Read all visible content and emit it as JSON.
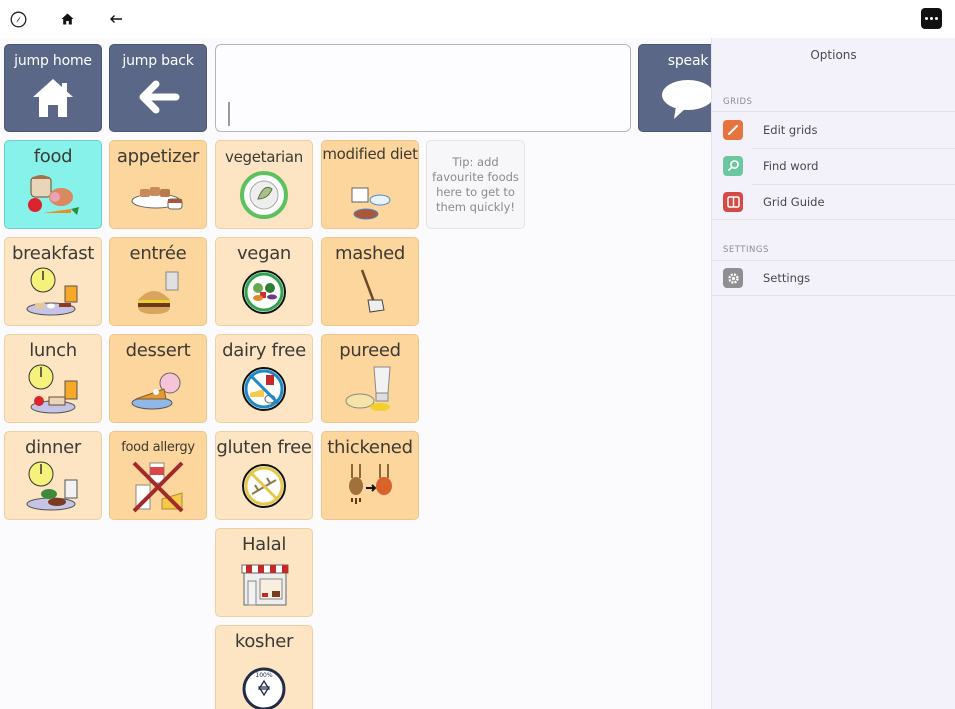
{
  "topbar": {
    "icons": [
      "compass-icon",
      "home-icon",
      "back-arrow-icon",
      "more-icon"
    ]
  },
  "nav": {
    "jump_home": "jump home",
    "jump_back": "jump back",
    "speak": "speak"
  },
  "message_bar": {
    "value": ""
  },
  "grid": {
    "tiles": {
      "food": "food",
      "appetizer": "appetizer",
      "vegetarian": "vegetarian",
      "modified_diet": "modified diet",
      "breakfast": "breakfast",
      "entree": "entrée",
      "vegan": "vegan",
      "mashed": "mashed",
      "lunch": "lunch",
      "dessert": "dessert",
      "dairy_free": "dairy free",
      "pureed": "pureed",
      "dinner": "dinner",
      "food_allergy": "food allergy",
      "gluten_free": "gluten free",
      "thickened": "thickened",
      "halal": "Halal",
      "kosher": "kosher"
    },
    "tip": "Tip: add favourite foods here to get to them quickly!",
    "colors": {
      "home_category": "#86f2ea",
      "light": "#fde5c3",
      "saturated": "#fcd69d",
      "nav": "#5a6787"
    }
  },
  "options_panel": {
    "title": "Options",
    "sections": [
      {
        "header": "GRIDS",
        "items": [
          {
            "label": "Edit grids",
            "icon": "pencil-icon",
            "color": "#e5743e"
          },
          {
            "label": "Find word",
            "icon": "magnifier-icon",
            "color": "#6cc7a0"
          },
          {
            "label": "Grid Guide",
            "icon": "book-icon",
            "color": "#d64a45"
          }
        ]
      },
      {
        "header": "SETTINGS",
        "items": [
          {
            "label": "Settings",
            "icon": "gear-icon",
            "color": "#8e8e93"
          }
        ]
      }
    ]
  }
}
